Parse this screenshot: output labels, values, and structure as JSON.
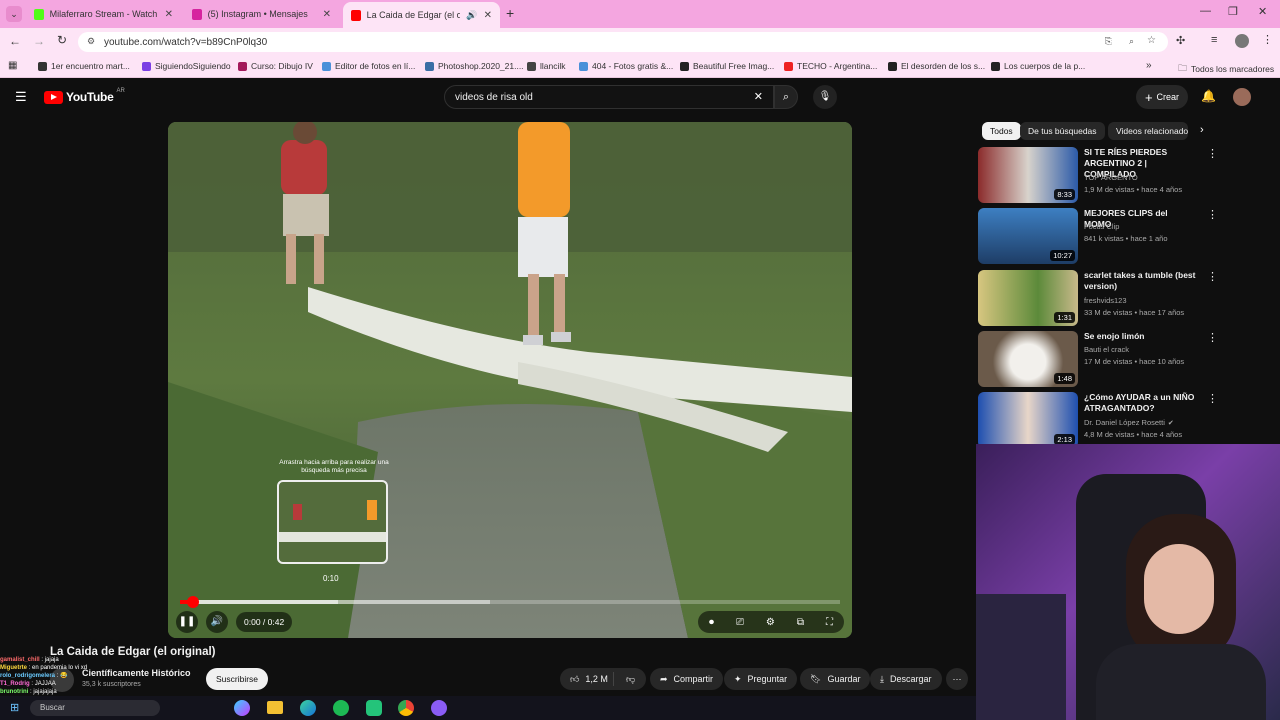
{
  "browser": {
    "tabs": [
      {
        "label": "Milaferraro Stream - Watch Live",
        "color": "#53fc18"
      },
      {
        "label": "(5) Instagram • Mensajes",
        "color": "#d6249f"
      },
      {
        "label": "La Caida de Edgar (el original)",
        "color": "#ff0000"
      }
    ],
    "url": "youtube.com/watch?v=b89CnP0lq30",
    "bookmarks": [
      {
        "label": "1er encuentro mart...",
        "color": "#333333"
      },
      {
        "label": "SiguiendoSiguiendo",
        "color": "#7b3fe4"
      },
      {
        "label": "Curso: Dibujo IV",
        "color": "#a3195b"
      },
      {
        "label": "Editor de fotos en lí...",
        "color": "#4a90d9"
      },
      {
        "label": "Photoshop.2020_21....",
        "color": "#3a6ea5"
      },
      {
        "label": "llancilk",
        "color": "#444444"
      },
      {
        "label": "404 - Fotos gratis &...",
        "color": "#4a90d9"
      },
      {
        "label": "Beautiful Free Imag...",
        "color": "#222222"
      },
      {
        "label": "TECHO - Argentina...",
        "color": "#e22"
      },
      {
        "label": "El desorden de los s...",
        "color": "#222222"
      },
      {
        "label": "Los cuerpos de la p...",
        "color": "#222222"
      }
    ],
    "all_bookmarks": "Todos los marcadores"
  },
  "youtube": {
    "logo": "YouTube",
    "region": "AR",
    "search_value": "videos de risa old",
    "create_label": "Crear",
    "video_title": "La Caida de Edgar (el original)",
    "channel": "Científicamente Histórico",
    "subscribers": "35,3 k suscriptores",
    "subscribe_label": "Suscribirse",
    "likes": "1,2 M",
    "share_label": "Compartir",
    "ask_label": "Preguntar",
    "save_label": "Guardar",
    "download_label": "Descargar"
  },
  "player": {
    "time": "0:00 / 0:42",
    "preview_time": "0:10",
    "drag_hint": "Arrastra hacia arriba para realizar una búsqueda más precisa",
    "progress_fraction": 0.02,
    "hover_fraction": 0.24,
    "buffer_fraction": 0.47
  },
  "chips": [
    "Todos",
    "De tus búsquedas",
    "Videos relacionados"
  ],
  "recommendations": [
    {
      "title": "SI TE RÍES PIERDES ARGENTINO 2 | COMPILADO",
      "channel": "TOP ARGENTO",
      "meta": "1,9 M de vistas • hace 4 años",
      "duration": "8:33"
    },
    {
      "title": "MEJORES CLIPS del MOMO",
      "channel": "Focus Clip",
      "meta": "841 k vistas • hace 1 año",
      "duration": "10:27"
    },
    {
      "title": "scarlet takes a tumble (best version)",
      "channel": "freshvids123",
      "meta": "33 M de vistas • hace 17 años",
      "duration": "1:31"
    },
    {
      "title": "Se enojo limón",
      "channel": "Bauti el crack",
      "meta": "17 M de vistas • hace 10 años",
      "duration": "1:48"
    },
    {
      "title": "¿Cómo AYUDAR a un NIÑO ATRAGANTADO?",
      "channel": "Dr. Daniel López Rosetti",
      "meta": "4,8 M de vistas • hace 4 años",
      "duration": "2:13"
    }
  ],
  "chat": [
    {
      "user": "gamalist_chill",
      "msg": "jajaja",
      "color": "#ff6b6b"
    },
    {
      "user": "Miguetrte",
      "msg": "en pandemia lo vi xd",
      "color": "#ffd93d"
    },
    {
      "user": "rolo_rodrigomelera",
      "msg": "😂",
      "color": "#6bcBff"
    },
    {
      "user": "T1_Rodrig",
      "msg": "JAJJAA",
      "color": "#ff6bd6"
    },
    {
      "user": "brunotrini",
      "msg": "jajajajaja",
      "color": "#7dff6b"
    }
  ],
  "taskbar": {
    "search_label": "Buscar"
  }
}
